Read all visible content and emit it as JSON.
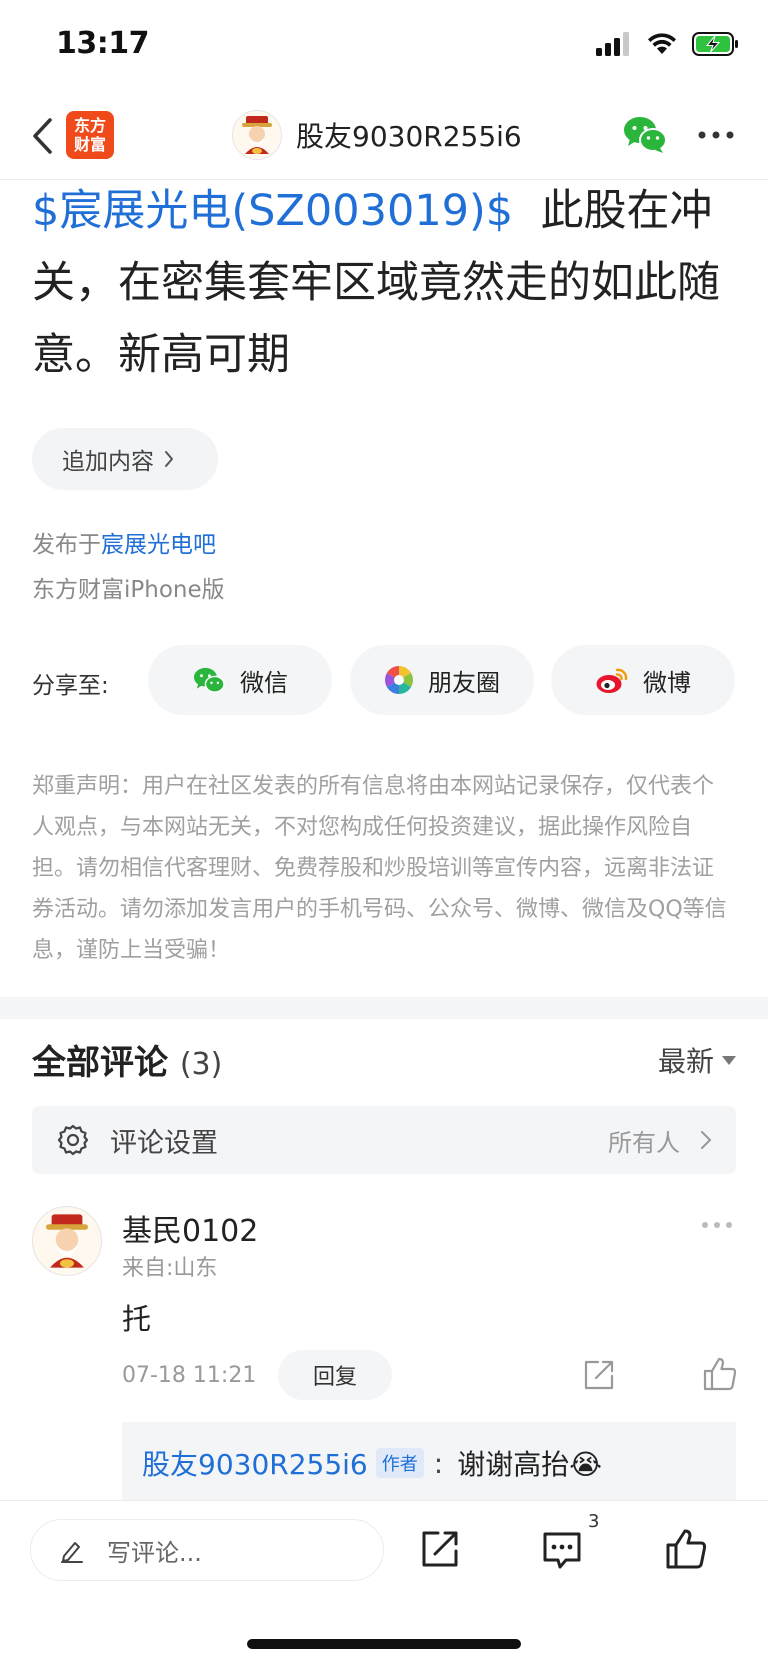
{
  "status_bar": {
    "time": "13:17"
  },
  "nav": {
    "logo_line1": "东方",
    "logo_line2": "财富",
    "user_name": "股友9030R255i6"
  },
  "post": {
    "stock_tag": "$宸展光电(SZ003019)$",
    "body": "此股在冲关，在密集套牢区域竟然走的如此随意。新高可期",
    "append_label": "追加内容",
    "published_prefix": "发布于",
    "published_bar": "宸展光电吧",
    "client": "东方财富iPhone版"
  },
  "share": {
    "label": "分享至:",
    "options": [
      "微信",
      "朋友圈",
      "微博"
    ]
  },
  "disclaimer": "郑重声明：用户在社区发表的所有信息将由本网站记录保存，仅代表个人观点，与本网站无关，不对您构成任何投资建议，据此操作风险自担。请勿相信代客理财、免费荐股和炒股培训等宣传内容，远离非法证券活动。请勿添加发言用户的手机号码、公众号、微博、微信及QQ等信息，谨防上当受骗！",
  "comments": {
    "title": "全部评论",
    "count": "(3)",
    "sort_label": "最新",
    "settings_label": "评论设置",
    "settings_value": "所有人",
    "items": [
      {
        "user": "基民0102",
        "from": "来自:山东",
        "text": "托",
        "time": "07-18 11:21",
        "reply_label": "回复",
        "sub_reply": {
          "user": "股友9030R255i6",
          "tag": "作者",
          "colon": ":",
          "text": "谢谢高抬😭"
        }
      }
    ]
  },
  "bottom_bar": {
    "write_placeholder": "写评论...",
    "comment_count": "3"
  },
  "colors": {
    "link_blue": "#1f6fd6",
    "brand_orange": "#f04a1a",
    "wechat_green": "#2ab53d"
  }
}
